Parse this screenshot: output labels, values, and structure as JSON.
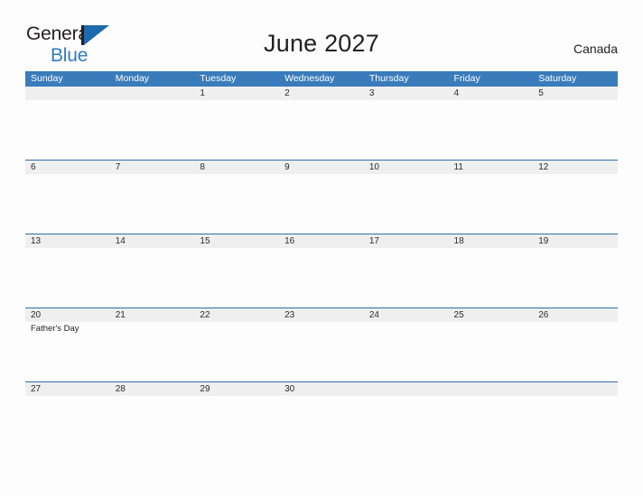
{
  "brand": {
    "word1": "General",
    "word2": "Blue",
    "mark_icon": "brand-triangle-icon",
    "colors": {
      "word1": "#231f20",
      "word2": "#2e7cc4",
      "mark": "#1b6aad"
    }
  },
  "header": {
    "title": "June 2027",
    "country": "Canada"
  },
  "colors": {
    "header_row_bg": "#3a7cbb",
    "header_row_text": "#ffffff",
    "date_band_bg": "#efefef",
    "row_divider": "#2f6da8",
    "page_bg": "#fdfdfd",
    "text": "#2b2b2b"
  },
  "calendar": {
    "weekdays": [
      "Sunday",
      "Monday",
      "Tuesday",
      "Wednesday",
      "Thursday",
      "Friday",
      "Saturday"
    ],
    "weeks": [
      {
        "days": [
          {
            "date": "",
            "event": ""
          },
          {
            "date": "",
            "event": ""
          },
          {
            "date": "1",
            "event": ""
          },
          {
            "date": "2",
            "event": ""
          },
          {
            "date": "3",
            "event": ""
          },
          {
            "date": "4",
            "event": ""
          },
          {
            "date": "5",
            "event": ""
          }
        ]
      },
      {
        "days": [
          {
            "date": "6",
            "event": ""
          },
          {
            "date": "7",
            "event": ""
          },
          {
            "date": "8",
            "event": ""
          },
          {
            "date": "9",
            "event": ""
          },
          {
            "date": "10",
            "event": ""
          },
          {
            "date": "11",
            "event": ""
          },
          {
            "date": "12",
            "event": ""
          }
        ]
      },
      {
        "days": [
          {
            "date": "13",
            "event": ""
          },
          {
            "date": "14",
            "event": ""
          },
          {
            "date": "15",
            "event": ""
          },
          {
            "date": "16",
            "event": ""
          },
          {
            "date": "17",
            "event": ""
          },
          {
            "date": "18",
            "event": ""
          },
          {
            "date": "19",
            "event": ""
          }
        ]
      },
      {
        "days": [
          {
            "date": "20",
            "event": "Father's Day"
          },
          {
            "date": "21",
            "event": ""
          },
          {
            "date": "22",
            "event": ""
          },
          {
            "date": "23",
            "event": ""
          },
          {
            "date": "24",
            "event": ""
          },
          {
            "date": "25",
            "event": ""
          },
          {
            "date": "26",
            "event": ""
          }
        ]
      },
      {
        "days": [
          {
            "date": "27",
            "event": ""
          },
          {
            "date": "28",
            "event": ""
          },
          {
            "date": "29",
            "event": ""
          },
          {
            "date": "30",
            "event": ""
          },
          {
            "date": "",
            "event": ""
          },
          {
            "date": "",
            "event": ""
          },
          {
            "date": "",
            "event": ""
          }
        ]
      }
    ]
  }
}
